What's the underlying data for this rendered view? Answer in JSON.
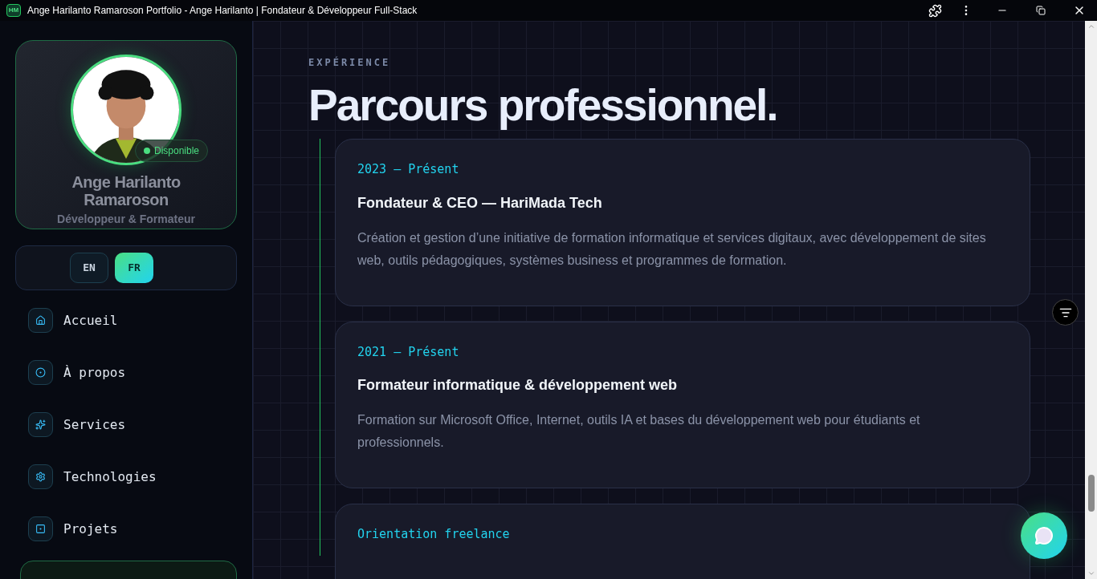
{
  "window": {
    "title": "Ange Harilanto Ramaroson Portfolio - Ange Harilanto | Fondateur & Développeur Full-Stack",
    "logo": "HM"
  },
  "profile": {
    "status": "Disponible",
    "name": "Ange Harilanto Ramaroson",
    "role": "Développeur & Formateur"
  },
  "languages": [
    {
      "label": "EN",
      "selected": false
    },
    {
      "label": "FR",
      "selected": true
    }
  ],
  "nav": [
    {
      "label": "Accueil",
      "kind": "home"
    },
    {
      "label": "À propos",
      "kind": "about"
    },
    {
      "label": "Services",
      "kind": "services"
    },
    {
      "label": "Technologies",
      "kind": "tech"
    },
    {
      "label": "Projets",
      "kind": "projects"
    }
  ],
  "section": {
    "eyebrow": "EXPÉRIENCE",
    "title": "Parcours professionnel."
  },
  "experiences": [
    {
      "period": "2023 — Présent",
      "title": "Fondateur & CEO — HariMada Tech",
      "description": "Création et gestion d’une initiative de formation informatique et services digitaux, avec développement de sites web, outils pédagogiques, systèmes business et programmes de formation."
    },
    {
      "period": "2021 — Présent",
      "title": "Formateur informatique & développement web",
      "description": "Formation sur Microsoft Office, Internet, outils IA et bases du développement web pour étudiants et professionnels."
    },
    {
      "period": "Orientation freelance"
    }
  ]
}
